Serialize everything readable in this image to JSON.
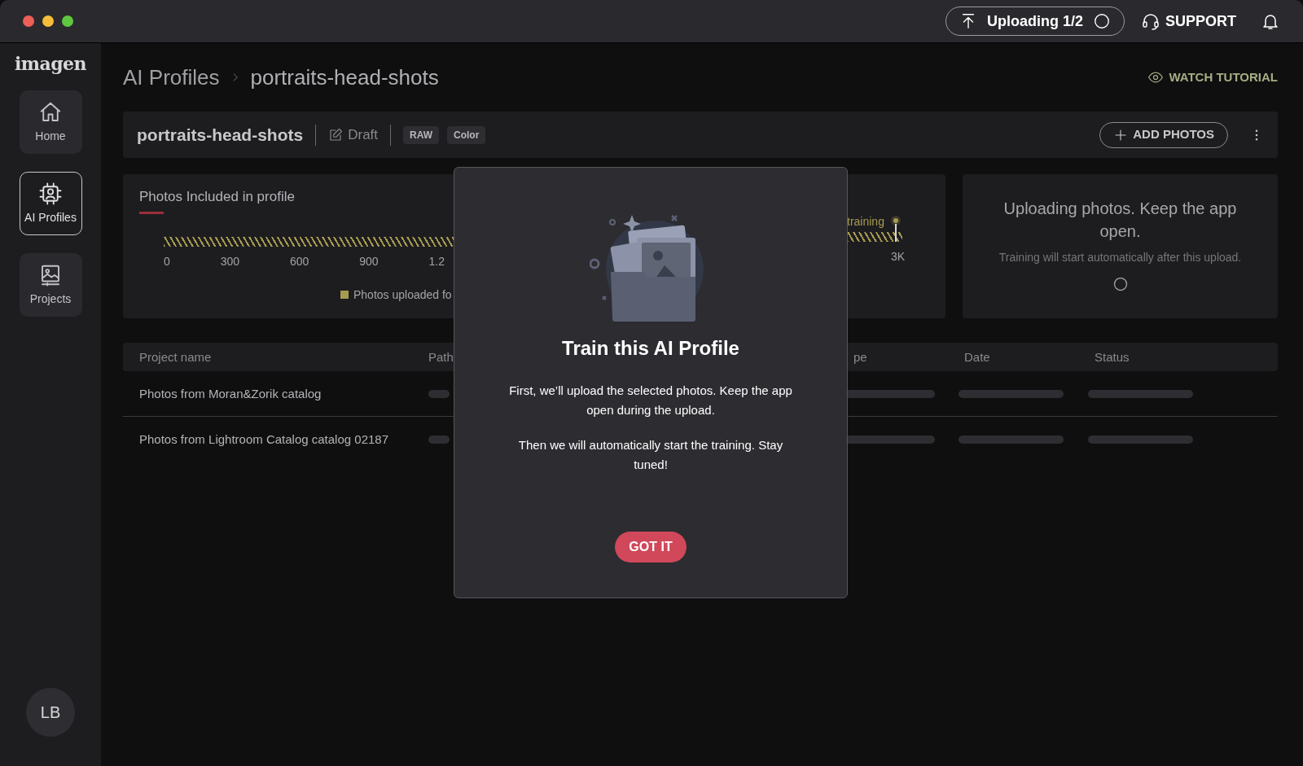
{
  "toolbar": {
    "upload_status": "Uploading 1/2",
    "support": "SUPPORT"
  },
  "sidebar": {
    "logo": "imagen",
    "items": [
      {
        "label": "Home",
        "kind": "home",
        "selected": false
      },
      {
        "label": "AI Profiles",
        "kind": "profiles",
        "selected": true
      },
      {
        "label": "Projects",
        "kind": "projects",
        "selected": false
      }
    ],
    "avatar": "LB"
  },
  "breadcrumb": [
    "AI Profiles",
    "portraits-head-shots"
  ],
  "watch_tutorial": "WATCH TUTORIAL",
  "profile_header": {
    "name": "portraits-head-shots",
    "status": "Draft",
    "tags": [
      "RAW",
      "Color"
    ],
    "add_button": "ADD PHOTOS"
  },
  "photos_card": {
    "title": "Photos Included in profile",
    "ticks": [
      "0",
      "300",
      "600",
      "900",
      "1.2"
    ],
    "end_tick": "3K",
    "marker_label": "training",
    "legend": "Photos uploaded fo"
  },
  "upload_card": {
    "title": "Uploading photos. Keep the app open.",
    "subtitle": "Training will start automatically after this upload."
  },
  "table": {
    "columns": [
      "Project name",
      "Path",
      "pe",
      "Date",
      "Status"
    ],
    "rows": [
      {
        "project_name": "Photos from Moran&Zorik catalog"
      },
      {
        "project_name": "Photos from Lightroom Catalog catalog 02187"
      }
    ]
  },
  "dialog": {
    "title": "Train this AI Profile",
    "paragraphs": [
      "First, we’ll upload the selected photos. Keep the app open during the upload.",
      "Then we will automatically start the training. Stay tuned!"
    ],
    "button": "GOT IT"
  }
}
